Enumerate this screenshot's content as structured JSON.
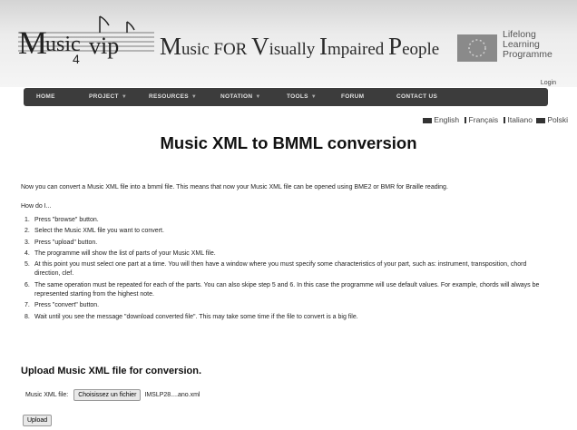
{
  "header": {
    "logo_text": "Music4vip",
    "tagline": [
      {
        "cap": "M",
        "rest": "usic FOR "
      },
      {
        "cap": "V",
        "rest": "isually "
      },
      {
        "cap": "I",
        "rest": "mpaired "
      },
      {
        "cap": "P",
        "rest": "eople"
      }
    ],
    "eu_program": [
      "Lifelong",
      "Learning",
      "Programme"
    ],
    "login_label": "Login"
  },
  "nav": [
    {
      "label": "HOME",
      "dropdown": false
    },
    {
      "label": "PROJECT",
      "dropdown": true
    },
    {
      "label": "RESOURCES",
      "dropdown": true
    },
    {
      "label": "NOTATION",
      "dropdown": true
    },
    {
      "label": "TOOLS",
      "dropdown": true
    },
    {
      "label": "FORUM",
      "dropdown": false
    },
    {
      "label": "CONTACT US",
      "dropdown": false
    }
  ],
  "languages": [
    "English",
    "Français",
    "Italiano",
    "Polski"
  ],
  "page": {
    "title": "Music XML to BMML conversion",
    "intro": "Now you can convert a Music XML file into a bmml file. This means that now your Music XML file can be opened using BME2 or BMR for Braille reading.",
    "howdo": "How do I...",
    "steps": [
      "Press \"browse\" button.",
      "Select the Music XML file you want to convert.",
      "Press \"upload\" button.",
      "The programme will show the list of parts of your Music XML file.",
      "At this point you must select one part at a time. You will then have a window where you must specify some characteristics of your part, such as: instrument, transposition, chord direction, clef.",
      "The same operation must be repeated for each of the parts. You can also skipe step 5 and 6. In this case the programme will use default values. For example, chords will always be represented starting from the highest note.",
      "Press \"convert\" button.",
      "Wait until you see the message \"download converted file\". This may take some time if the file to convert is a big file."
    ]
  },
  "upload": {
    "heading": "Upload Music XML file for conversion.",
    "file_label": "Music XML file:",
    "file_button": "Choisissez un fichier",
    "file_name": "IMSLP28....ano.xml",
    "upload_button": "Upload"
  }
}
